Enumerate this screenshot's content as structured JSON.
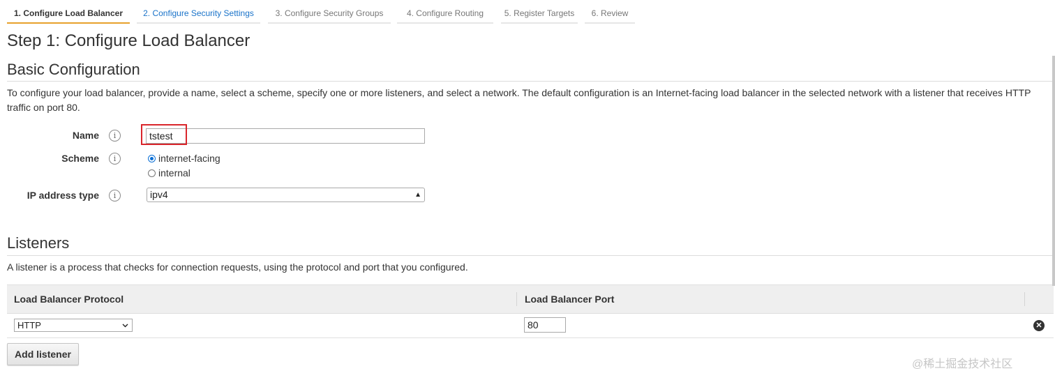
{
  "wizard": {
    "tabs": [
      {
        "label": "1. Configure Load Balancer",
        "state": "active"
      },
      {
        "label": "2. Configure Security Settings",
        "state": "link"
      },
      {
        "label": "3. Configure Security Groups",
        "state": "inactive"
      },
      {
        "label": "4. Configure Routing",
        "state": "inactive"
      },
      {
        "label": "5. Register Targets",
        "state": "inactive"
      },
      {
        "label": "6. Review",
        "state": "inactive"
      }
    ]
  },
  "page": {
    "title": "Step 1: Configure Load Balancer"
  },
  "basic": {
    "heading": "Basic Configuration",
    "description": "To configure your load balancer, provide a name, select a scheme, specify one or more listeners, and select a network. The default configuration is an Internet-facing load balancer in the selected network with a listener that receives HTTP traffic on port 80.",
    "name_label": "Name",
    "name_value": "tstest",
    "scheme_label": "Scheme",
    "scheme_options": [
      {
        "label": "internet-facing",
        "checked": true
      },
      {
        "label": "internal",
        "checked": false
      }
    ],
    "ip_label": "IP address type",
    "ip_value": "ipv4",
    "info_icon": "i"
  },
  "listeners": {
    "heading": "Listeners",
    "description": "A listener is a process that checks for connection requests, using the protocol and port that you configured.",
    "col_protocol": "Load Balancer Protocol",
    "col_port": "Load Balancer Port",
    "rows": [
      {
        "protocol": "HTTP",
        "port": "80"
      }
    ],
    "add_button": "Add listener"
  },
  "watermark": "@稀土掘金技术社区",
  "colors": {
    "active_tab": "#e7a02b",
    "link": "#1a73c9",
    "highlight": "#d9252b",
    "radio": "#0a6fd6"
  },
  "icons": {
    "info": "info-icon",
    "remove": "remove-circle-icon",
    "dropdown": "chevron-down-icon"
  }
}
